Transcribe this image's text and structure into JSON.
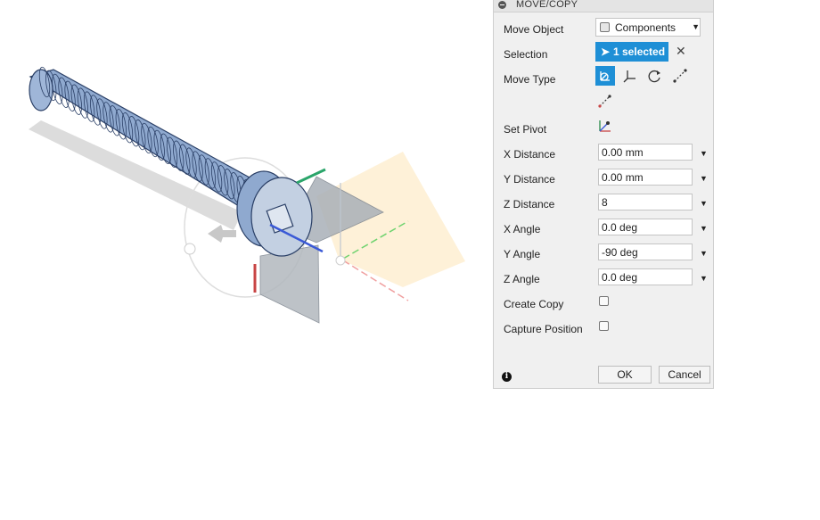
{
  "panel": {
    "title": "MOVE/COPY",
    "move_object": {
      "label": "Move Object",
      "value": "Components"
    },
    "selection": {
      "label": "Selection",
      "value": "1 selected"
    },
    "move_type": {
      "label": "Move Type"
    },
    "set_pivot": {
      "label": "Set Pivot"
    },
    "fields": [
      {
        "label": "X Distance",
        "value": "0.00 mm"
      },
      {
        "label": "Y Distance",
        "value": "0.00 mm"
      },
      {
        "label": "Z Distance",
        "value": "8"
      },
      {
        "label": "X Angle",
        "value": "0.0 deg"
      },
      {
        "label": "Y Angle",
        "value": "-90 deg"
      },
      {
        "label": "Z Angle",
        "value": "0.0 deg"
      }
    ],
    "create_copy": {
      "label": "Create Copy",
      "checked": false
    },
    "capture_position": {
      "label": "Capture Position",
      "checked": false
    },
    "ok_label": "OK",
    "cancel_label": "Cancel"
  },
  "colors": {
    "accent": "#1e8fd6",
    "model": "#8fa9cf",
    "model_edge": "#2a3f66"
  },
  "icons": [
    "cube-icon",
    "cursor-icon",
    "close-icon",
    "free-move-icon",
    "translate-icon",
    "rotate-icon",
    "point-to-point-icon",
    "point-to-position-icon",
    "pivot-icon",
    "info-icon",
    "dropdown-arrow-icon"
  ]
}
